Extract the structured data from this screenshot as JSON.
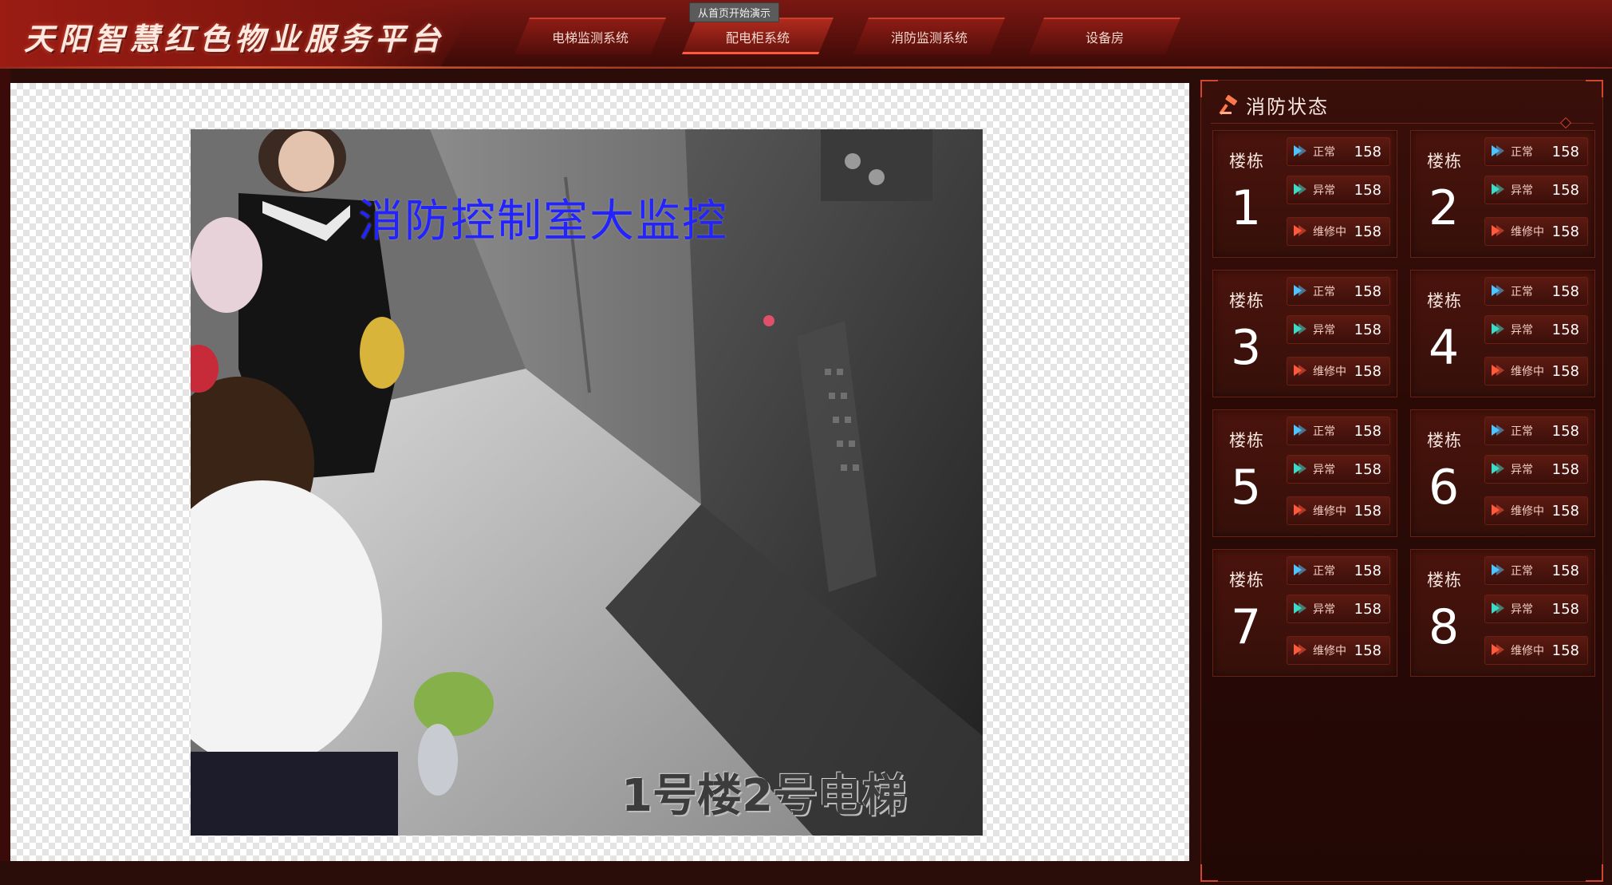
{
  "header": {
    "title": "天阳智慧红色物业服务平台",
    "tooltip": "从首页开始演示",
    "tabs": [
      {
        "label": "电梯监测系统",
        "active": false
      },
      {
        "label": "配电柜系统",
        "active": true
      },
      {
        "label": "消防监测系统",
        "active": false
      },
      {
        "label": "设备房",
        "active": false
      }
    ]
  },
  "video": {
    "overlay_title": "消防控制室大监控",
    "caption": "1号楼2号电梯"
  },
  "panel": {
    "title": "消防状态",
    "icon": "fire-hammer-icon",
    "building_label": "楼栋",
    "status_labels": {
      "normal": "正常",
      "abnormal": "异常",
      "repair": "维修中"
    },
    "status_colors": {
      "normal": "#4fc3ff",
      "abnormal": "#3fd9c8",
      "repair": "#ff5a3c"
    },
    "buildings": [
      {
        "num": "1",
        "normal": "158",
        "abnormal": "158",
        "repair": "158"
      },
      {
        "num": "2",
        "normal": "158",
        "abnormal": "158",
        "repair": "158"
      },
      {
        "num": "3",
        "normal": "158",
        "abnormal": "158",
        "repair": "158"
      },
      {
        "num": "4",
        "normal": "158",
        "abnormal": "158",
        "repair": "158"
      },
      {
        "num": "5",
        "normal": "158",
        "abnormal": "158",
        "repair": "158"
      },
      {
        "num": "6",
        "normal": "158",
        "abnormal": "158",
        "repair": "158"
      },
      {
        "num": "7",
        "normal": "158",
        "abnormal": "158",
        "repair": "158"
      },
      {
        "num": "8",
        "normal": "158",
        "abnormal": "158",
        "repair": "158"
      }
    ]
  }
}
